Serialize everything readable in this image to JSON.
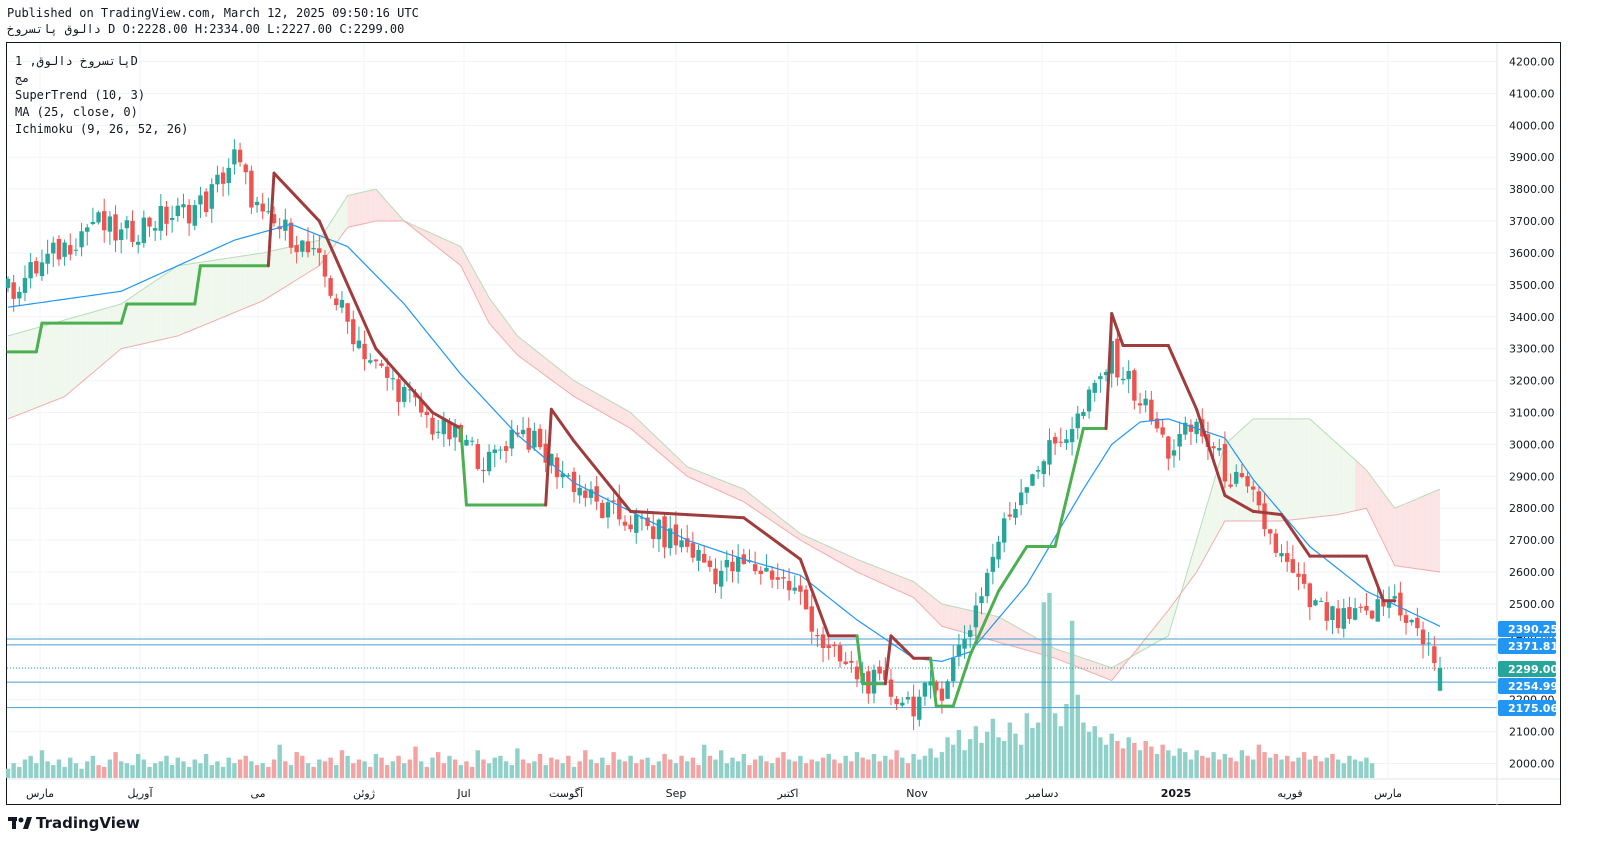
{
  "header": {
    "published": "Published on TradingView.com, March 12, 2025 09:50:16 UTC",
    "symbol_line": "دالوق  پاتسروخ D O:2228.00 H:2334.00 L:2227.00 C:2299.00"
  },
  "legend": {
    "symbol": "پاتسروخ دالوق, 1D",
    "exchange": "مج",
    "supertrend": "SuperTrend (10, 3)",
    "ma": "MA (25, close, 0)",
    "ichimoku": "Ichimoku (9, 26, 52, 26)"
  },
  "brand": {
    "logo_text": "TradingView"
  },
  "colors": {
    "up": "#26a69a",
    "down": "#ef5350",
    "up_fill": "#f0f8ee",
    "down_fill": "#fce4e4",
    "supertrend_up": "#4caf50",
    "supertrend_down": "#a13c3c",
    "ma": "#2196f3",
    "hline": "#4a9ed6",
    "label_blue": "#2196f3",
    "label_green": "#26a69a",
    "vol_up": "#8fd1c8",
    "vol_down": "#f4a3a3"
  },
  "chart_data": {
    "type": "candlestick",
    "interval": "1D",
    "x_axis_labels": [
      "مارس",
      "آوریل",
      "می",
      "ژوئن",
      "Jul",
      "آگوست",
      "Sep",
      "اکتبر",
      "Nov",
      "دسامبر",
      "2025",
      "فوریه",
      "مارس"
    ],
    "y_axis_labels": [
      "4200.00",
      "4100.00",
      "4000.00",
      "3900.00",
      "3800.00",
      "3700.00",
      "3600.00",
      "3500.00",
      "3400.00",
      "3300.00",
      "3200.00",
      "3100.00",
      "3000.00",
      "2900.00",
      "2800.00",
      "2700.00",
      "2600.00",
      "2500.00",
      "2400.00",
      "2300.00",
      "2200.00",
      "2100.00",
      "2000.00"
    ],
    "ylim": [
      1950,
      4250
    ],
    "last_ohlc": {
      "open": 2228.0,
      "high": 2334.0,
      "low": 2227.0,
      "close": 2299.0
    },
    "price_labels": [
      {
        "value": "2390.25",
        "style": "blue"
      },
      {
        "value": "2371.81",
        "style": "blue"
      },
      {
        "value": "2299.00",
        "style": "green"
      },
      {
        "value": "2254.99",
        "style": "blue"
      },
      {
        "value": "2175.06",
        "style": "blue"
      }
    ],
    "price_trend": [
      [
        0,
        3480
      ],
      [
        10,
        3620
      ],
      [
        15,
        3700
      ],
      [
        20,
        3650
      ],
      [
        25,
        3700
      ],
      [
        30,
        3720
      ],
      [
        35,
        3760
      ],
      [
        40,
        3900
      ],
      [
        45,
        3700
      ],
      [
        50,
        3660
      ],
      [
        55,
        3560
      ],
      [
        60,
        3380
      ],
      [
        65,
        3240
      ],
      [
        70,
        3160
      ],
      [
        75,
        3060
      ],
      [
        80,
        3010
      ],
      [
        85,
        2940
      ],
      [
        90,
        3060
      ],
      [
        95,
        2960
      ],
      [
        100,
        2880
      ],
      [
        105,
        2790
      ],
      [
        110,
        2760
      ],
      [
        115,
        2720
      ],
      [
        120,
        2680
      ],
      [
        125,
        2600
      ],
      [
        130,
        2620
      ],
      [
        135,
        2600
      ],
      [
        140,
        2520
      ],
      [
        145,
        2340
      ],
      [
        150,
        2280
      ],
      [
        155,
        2230
      ],
      [
        160,
        2190
      ],
      [
        165,
        2240
      ],
      [
        170,
        2440
      ],
      [
        175,
        2700
      ],
      [
        180,
        2900
      ],
      [
        185,
        3000
      ],
      [
        190,
        3100
      ],
      [
        195,
        3280
      ],
      [
        200,
        3140
      ],
      [
        205,
        2980
      ],
      [
        210,
        3060
      ],
      [
        215,
        2920
      ],
      [
        220,
        2820
      ],
      [
        225,
        2640
      ],
      [
        230,
        2500
      ],
      [
        235,
        2440
      ],
      [
        240,
        2460
      ],
      [
        245,
        2520
      ],
      [
        250,
        2380
      ],
      [
        253,
        2299
      ]
    ],
    "ma_line": [
      [
        0,
        3430
      ],
      [
        20,
        3480
      ],
      [
        40,
        3640
      ],
      [
        50,
        3690
      ],
      [
        60,
        3620
      ],
      [
        70,
        3440
      ],
      [
        80,
        3220
      ],
      [
        90,
        3030
      ],
      [
        100,
        2880
      ],
      [
        110,
        2790
      ],
      [
        120,
        2700
      ],
      [
        130,
        2640
      ],
      [
        140,
        2590
      ],
      [
        150,
        2450
      ],
      [
        160,
        2330
      ],
      [
        165,
        2320
      ],
      [
        170,
        2350
      ],
      [
        180,
        2560
      ],
      [
        190,
        2860
      ],
      [
        195,
        3000
      ],
      [
        200,
        3070
      ],
      [
        205,
        3080
      ],
      [
        215,
        3020
      ],
      [
        220,
        2890
      ],
      [
        230,
        2680
      ],
      [
        240,
        2540
      ],
      [
        253,
        2430
      ]
    ],
    "supertrend": [
      [
        0,
        3290
      ],
      [
        5,
        3290
      ],
      [
        6,
        3380
      ],
      [
        20,
        3380
      ],
      [
        21,
        3440
      ],
      [
        33,
        3440
      ],
      [
        34,
        3560
      ],
      [
        46,
        3560
      ],
      [
        47,
        3850
      ],
      [
        55,
        3700
      ],
      [
        65,
        3300
      ],
      [
        70,
        3200
      ],
      [
        75,
        3100
      ],
      [
        80,
        3050
      ],
      [
        81,
        2810
      ],
      [
        95,
        2810
      ],
      [
        96,
        3110
      ],
      [
        100,
        3010
      ],
      [
        110,
        2790
      ],
      [
        120,
        2780
      ],
      [
        130,
        2770
      ],
      [
        140,
        2640
      ],
      [
        145,
        2400
      ],
      [
        150,
        2400
      ],
      [
        151,
        2250
      ],
      [
        155,
        2250
      ],
      [
        156,
        2400
      ],
      [
        160,
        2330
      ],
      [
        163,
        2330
      ],
      [
        164,
        2180
      ],
      [
        167,
        2180
      ],
      [
        170,
        2340
      ],
      [
        175,
        2540
      ],
      [
        180,
        2680
      ],
      [
        185,
        2680
      ],
      [
        190,
        3050
      ],
      [
        194,
        3050
      ],
      [
        195,
        3410
      ],
      [
        197,
        3310
      ],
      [
        205,
        3310
      ],
      [
        210,
        3110
      ],
      [
        215,
        2840
      ],
      [
        220,
        2790
      ],
      [
        225,
        2780
      ],
      [
        230,
        2650
      ],
      [
        235,
        2650
      ],
      [
        240,
        2650
      ],
      [
        243,
        2510
      ],
      [
        245,
        2510
      ]
    ],
    "cloud_top": [
      [
        0,
        3340
      ],
      [
        10,
        3390
      ],
      [
        20,
        3440
      ],
      [
        30,
        3560
      ],
      [
        45,
        3600
      ],
      [
        55,
        3640
      ],
      [
        60,
        3780
      ],
      [
        65,
        3800
      ],
      [
        70,
        3700
      ],
      [
        80,
        3620
      ],
      [
        85,
        3460
      ],
      [
        90,
        3340
      ],
      [
        100,
        3200
      ],
      [
        110,
        3100
      ],
      [
        120,
        2930
      ],
      [
        130,
        2860
      ],
      [
        140,
        2720
      ],
      [
        150,
        2640
      ],
      [
        160,
        2570
      ],
      [
        165,
        2500
      ],
      [
        175,
        2460
      ],
      [
        185,
        2360
      ],
      [
        195,
        2300
      ],
      [
        205,
        2400
      ],
      [
        215,
        3000
      ],
      [
        220,
        3080
      ],
      [
        230,
        3080
      ],
      [
        235,
        3000
      ],
      [
        240,
        2920
      ],
      [
        245,
        2800
      ],
      [
        253,
        2860
      ]
    ],
    "cloud_bottom": [
      [
        0,
        3080
      ],
      [
        10,
        3150
      ],
      [
        20,
        3300
      ],
      [
        30,
        3340
      ],
      [
        45,
        3450
      ],
      [
        55,
        3560
      ],
      [
        60,
        3680
      ],
      [
        65,
        3700
      ],
      [
        70,
        3700
      ],
      [
        80,
        3560
      ],
      [
        85,
        3380
      ],
      [
        90,
        3280
      ],
      [
        100,
        3150
      ],
      [
        110,
        3050
      ],
      [
        120,
        2900
      ],
      [
        130,
        2820
      ],
      [
        140,
        2700
      ],
      [
        150,
        2600
      ],
      [
        160,
        2520
      ],
      [
        165,
        2430
      ],
      [
        175,
        2380
      ],
      [
        185,
        2330
      ],
      [
        195,
        2260
      ],
      [
        205,
        2480
      ],
      [
        210,
        2600
      ],
      [
        215,
        2760
      ],
      [
        225,
        2760
      ],
      [
        235,
        2780
      ],
      [
        240,
        2800
      ],
      [
        245,
        2620
      ],
      [
        253,
        2600
      ]
    ],
    "volume": [
      0.05,
      0.08,
      0.06,
      0.1,
      0.12,
      0.08,
      0.15,
      0.09,
      0.07,
      0.1,
      0.06,
      0.11,
      0.08,
      0.05,
      0.09,
      0.12,
      0.07,
      0.06,
      0.1,
      0.14,
      0.09,
      0.08,
      0.07,
      0.13,
      0.1,
      0.06,
      0.08,
      0.09,
      0.12,
      0.07,
      0.11,
      0.09,
      0.06,
      0.1,
      0.08,
      0.13,
      0.07,
      0.09,
      0.06,
      0.11,
      0.08,
      0.1,
      0.12,
      0.09,
      0.07,
      0.08,
      0.06,
      0.1,
      0.18,
      0.09,
      0.07,
      0.14,
      0.12,
      0.08,
      0.06,
      0.1,
      0.09,
      0.11,
      0.07,
      0.15,
      0.12,
      0.08,
      0.1,
      0.09,
      0.06,
      0.13,
      0.11,
      0.07,
      0.09,
      0.12,
      0.08,
      0.1,
      0.17,
      0.09,
      0.06,
      0.11,
      0.14,
      0.08,
      0.12,
      0.1,
      0.07,
      0.09,
      0.06,
      0.15,
      0.1,
      0.08,
      0.11,
      0.12,
      0.09,
      0.07,
      0.16,
      0.1,
      0.08,
      0.09,
      0.13,
      0.07,
      0.11,
      0.1,
      0.08,
      0.12,
      0.06,
      0.09,
      0.15,
      0.1,
      0.08,
      0.11,
      0.07,
      0.14,
      0.1,
      0.09,
      0.12,
      0.08,
      0.1,
      0.11,
      0.07,
      0.09,
      0.13,
      0.1,
      0.08,
      0.12,
      0.09,
      0.11,
      0.07,
      0.18,
      0.12,
      0.1,
      0.15,
      0.08,
      0.11,
      0.09,
      0.13,
      0.07,
      0.1,
      0.12,
      0.09,
      0.08,
      0.11,
      0.14,
      0.1,
      0.09,
      0.12,
      0.08,
      0.1,
      0.09,
      0.11,
      0.13,
      0.1,
      0.08,
      0.12,
      0.09,
      0.14,
      0.11,
      0.1,
      0.13,
      0.09,
      0.12,
      0.1,
      0.15,
      0.11,
      0.08,
      0.13,
      0.1,
      0.12,
      0.16,
      0.11,
      0.14,
      0.22,
      0.18,
      0.26,
      0.15,
      0.21,
      0.28,
      0.19,
      0.25,
      0.32,
      0.22,
      0.2,
      0.3,
      0.24,
      0.18,
      0.35,
      0.27,
      0.3,
      0.95,
      1.0,
      0.35,
      0.28,
      0.4,
      0.85,
      0.45,
      0.3,
      0.25,
      0.28,
      0.22,
      0.18,
      0.24,
      0.2,
      0.16,
      0.22,
      0.19,
      0.15,
      0.2,
      0.17,
      0.13,
      0.18,
      0.15,
      0.12,
      0.16,
      0.14,
      0.1,
      0.15,
      0.12,
      0.11,
      0.14,
      0.1,
      0.13,
      0.11,
      0.09,
      0.15,
      0.12,
      0.1,
      0.18,
      0.14,
      0.11,
      0.13,
      0.1,
      0.12,
      0.09,
      0.11,
      0.14,
      0.1,
      0.12,
      0.09,
      0.11,
      0.13,
      0.1,
      0.08,
      0.12,
      0.1,
      0.09,
      0.11,
      0.08
    ]
  }
}
